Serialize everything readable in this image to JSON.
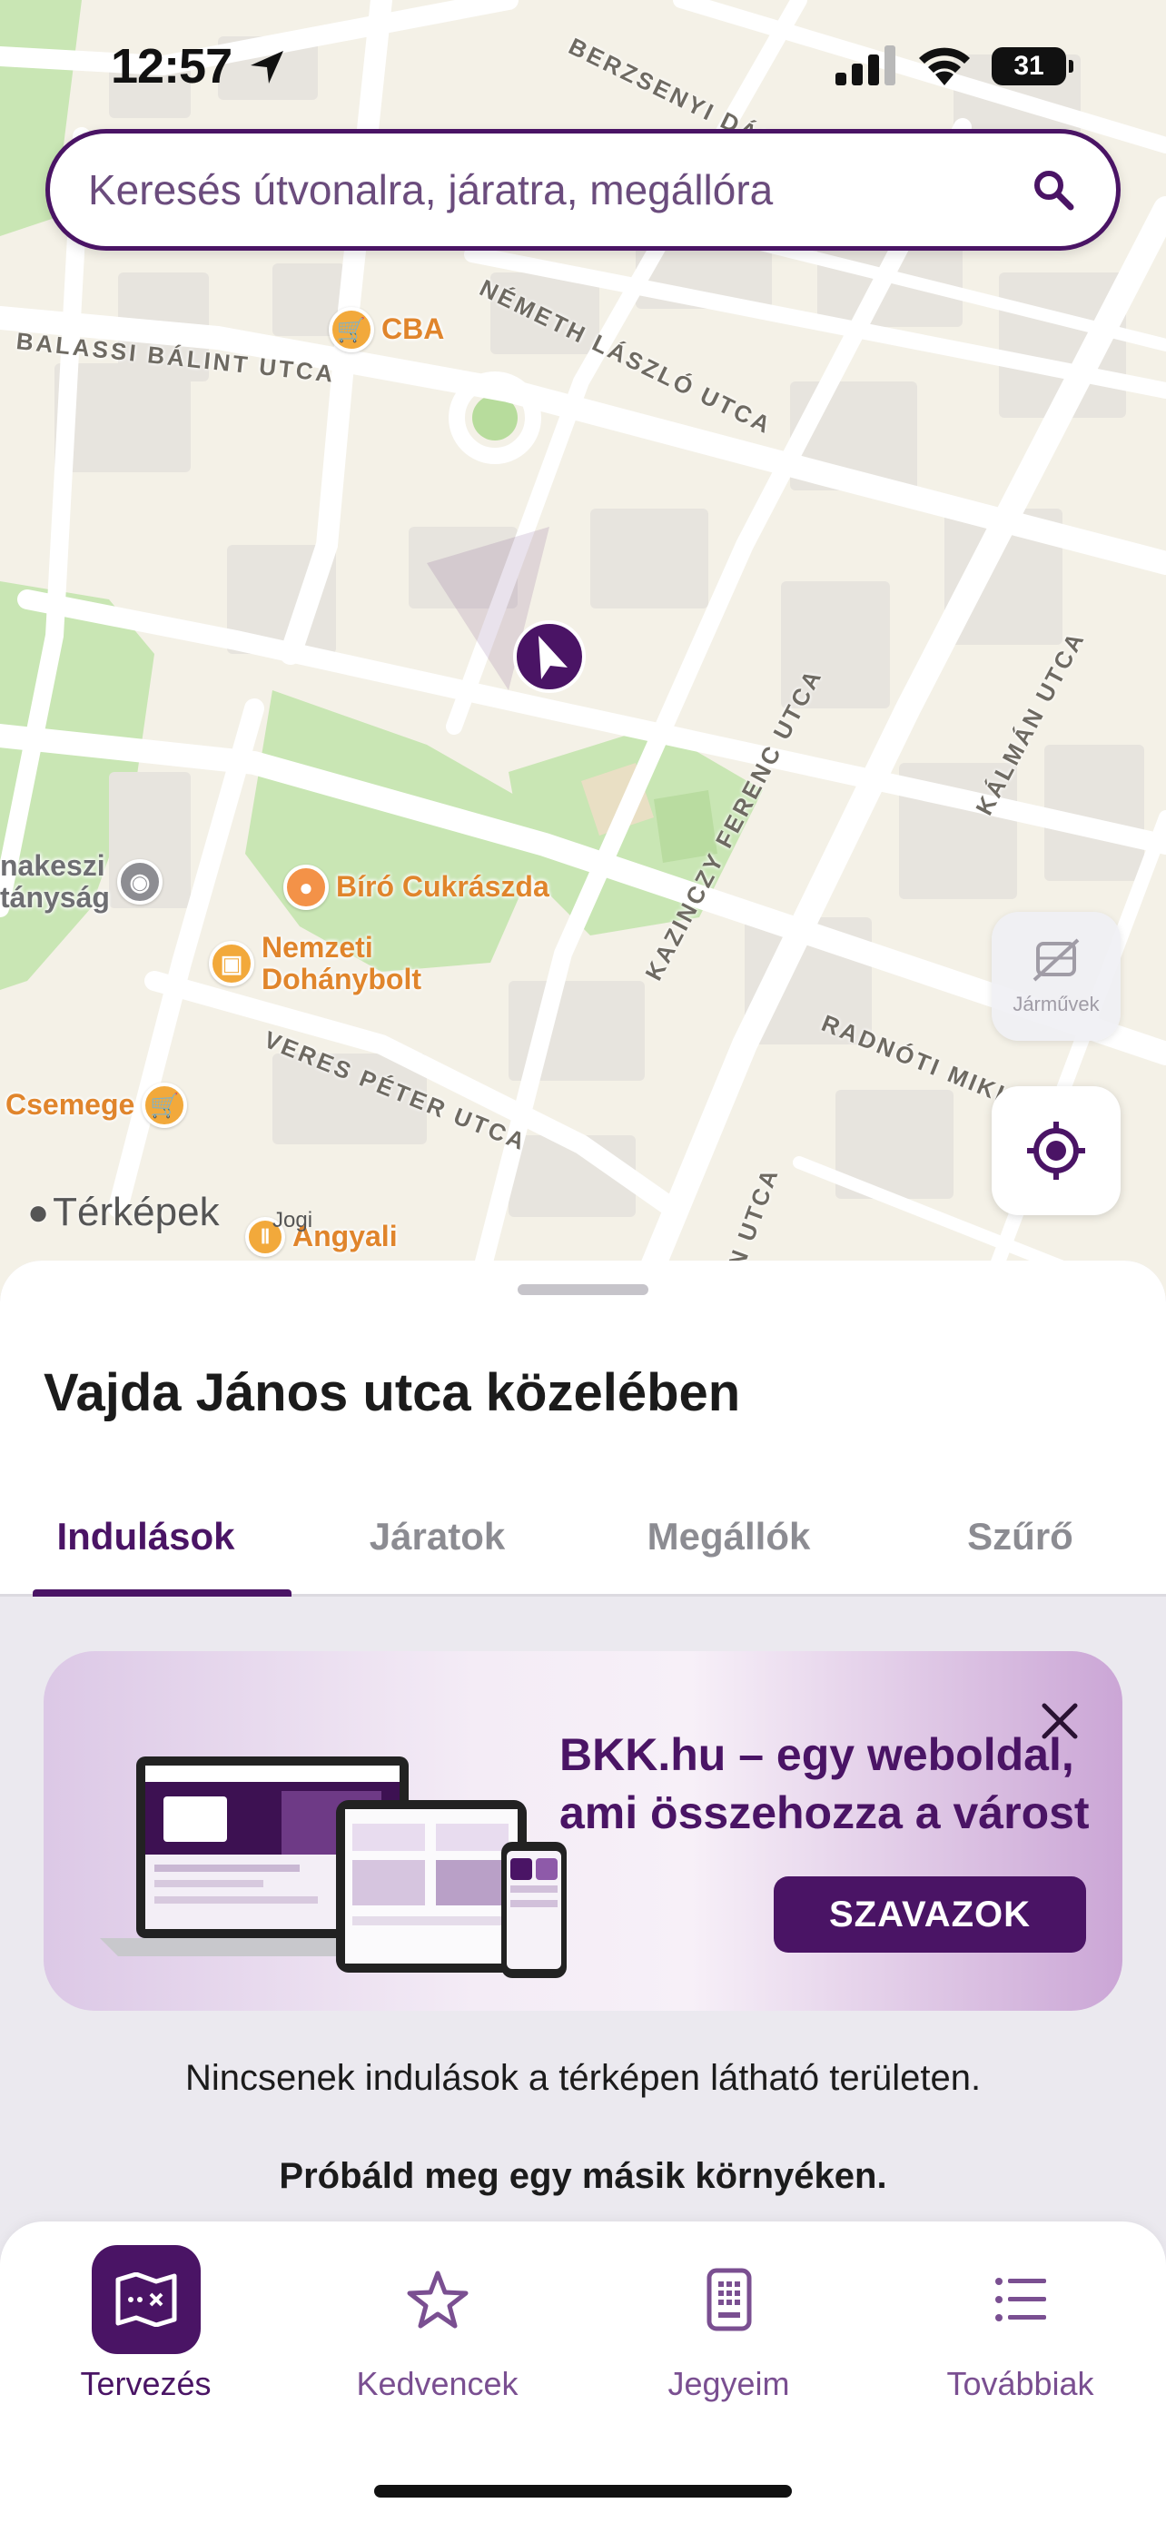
{
  "status_bar": {
    "time": "12:57",
    "battery": "31"
  },
  "search": {
    "placeholder": "Keresés útvonalra, járatra, megállóra"
  },
  "map": {
    "streets": [
      "BERZSENYI DÁN",
      "BALASSI BÁLINT UTCA",
      "NÉMETH LÁSZLÓ UTCA",
      "KAZINCZY FERENC UTCA",
      "KÁLMÁN UTCA",
      "RADNÓTI MIKLÓ",
      "VERES PÉTER UTCA",
      "N UTCA"
    ],
    "pois": {
      "cba": "CBA",
      "biro": "Bíró Cukrászda",
      "nemzeti_line1": "Nemzeti",
      "nemzeti_line2": "Dohánybolt",
      "csemege": "Csemege",
      "police_line1": "nakeszi",
      "police_line2": "tányság",
      "angyali": "Angyali"
    },
    "vehicles_label": "Járművek",
    "attribution": "Térképek",
    "legal": "Jogi"
  },
  "sheet": {
    "title": "Vajda János utca közelében",
    "tabs": [
      {
        "label": "Indulások",
        "active": true
      },
      {
        "label": "Járatok",
        "active": false
      },
      {
        "label": "Megállók",
        "active": false
      },
      {
        "label": "Szűrő",
        "active": false
      }
    ],
    "banner": {
      "title_line1": "BKK.hu – egy weboldal,",
      "title_line2": "ami összehozza a várost",
      "button": "SZAVAZOK"
    },
    "empty_message": "Nincsenek indulások a térképen látható területen.",
    "empty_hint": "Próbáld meg egy másik környéken."
  },
  "tabbar": {
    "items": [
      {
        "label": "Tervezés",
        "icon": "map-plan-icon",
        "active": true
      },
      {
        "label": "Kedvencek",
        "icon": "star-icon",
        "active": false
      },
      {
        "label": "Jegyeim",
        "icon": "ticket-icon",
        "active": false
      },
      {
        "label": "Továbbiak",
        "icon": "list-icon",
        "active": false
      }
    ]
  },
  "colors": {
    "brand": "#4a1465",
    "poi_orange": "#e0852c",
    "map_bg": "#f4f1e7",
    "park": "#c5e4b0"
  }
}
